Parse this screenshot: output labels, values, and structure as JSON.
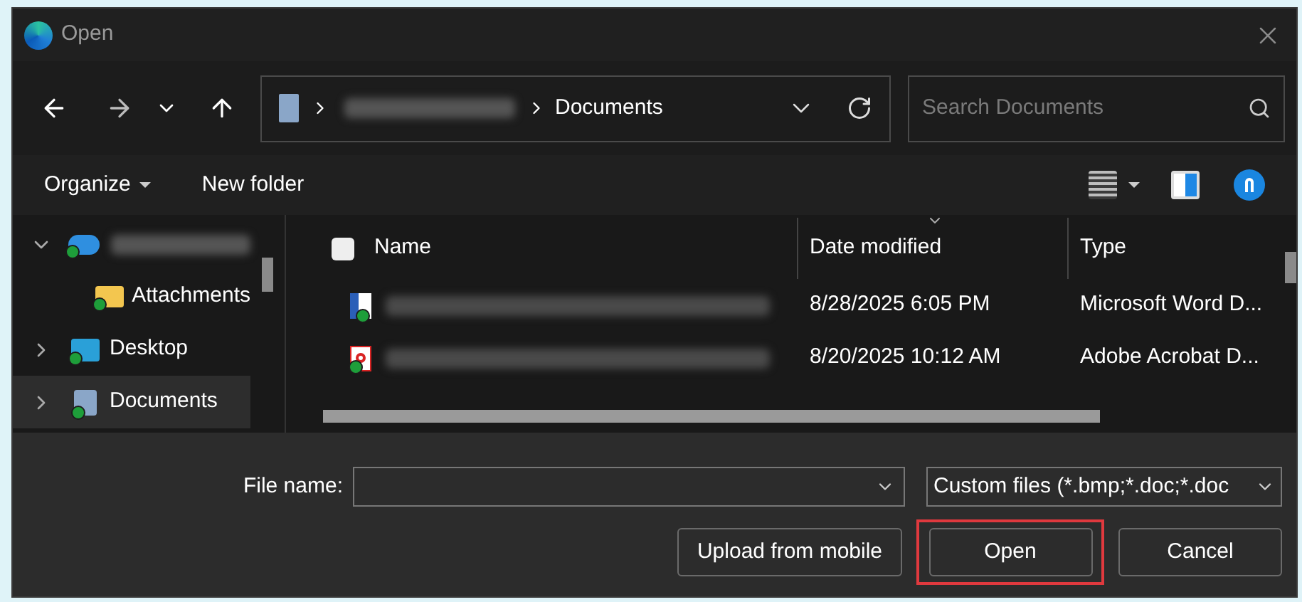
{
  "window": {
    "title": "Open"
  },
  "address": {
    "segments": [
      "Documents"
    ]
  },
  "search": {
    "placeholder": "Search Documents"
  },
  "toolbar": {
    "organize": "Organize",
    "new_folder": "New folder"
  },
  "sidebar": {
    "items": [
      {
        "kind": "cloud",
        "expanded": true,
        "selected": false
      },
      {
        "kind": "folder",
        "label": "Attachments",
        "selected": false
      },
      {
        "kind": "desktop",
        "label": "Desktop",
        "expanded": false,
        "selected": false
      },
      {
        "kind": "documents",
        "label": "Documents",
        "expanded": false,
        "selected": true
      }
    ]
  },
  "table": {
    "columns": [
      {
        "label": "Name",
        "sorted": false
      },
      {
        "label": "Date modified",
        "sorted": true
      },
      {
        "label": "Type",
        "sorted": false
      }
    ],
    "rows": [
      {
        "kind": "word",
        "date": "8/28/2025 6:05 PM",
        "type": "Microsoft Word D..."
      },
      {
        "kind": "pdf",
        "date": "8/20/2025 10:12 AM",
        "type": "Adobe Acrobat D..."
      }
    ]
  },
  "footer": {
    "file_name_label": "File name:",
    "filter": "Custom files (*.bmp;*.doc;*.doc",
    "buttons": [
      {
        "label": "Upload from mobile",
        "highlighted": false
      },
      {
        "label": "Open",
        "highlighted": true
      },
      {
        "label": "Cancel",
        "highlighted": false
      }
    ]
  }
}
